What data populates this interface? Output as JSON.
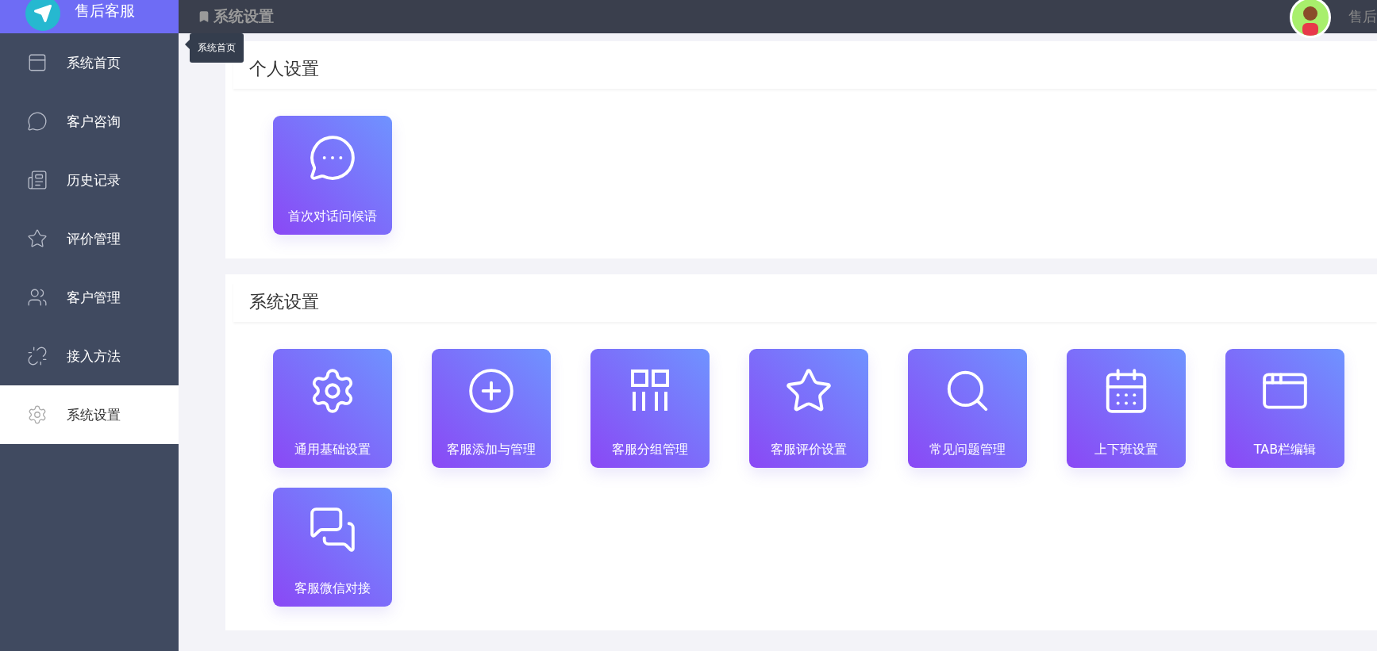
{
  "brand": {
    "title": "售后客服"
  },
  "sidebar": {
    "items": [
      {
        "label": "系统首页",
        "selected": false
      },
      {
        "label": "客户咨询",
        "selected": false
      },
      {
        "label": "历史记录",
        "selected": false
      },
      {
        "label": "评价管理",
        "selected": false
      },
      {
        "label": "客户管理",
        "selected": false
      },
      {
        "label": "接入方法",
        "selected": false
      },
      {
        "label": "系统设置",
        "selected": true
      }
    ]
  },
  "tooltip": "系统首页",
  "header": {
    "title": "系统设置",
    "user": "售后"
  },
  "sections": [
    {
      "title": "个人设置",
      "cards": [
        {
          "label": "首次对话问候语"
        }
      ]
    },
    {
      "title": "系统设置",
      "cards": [
        {
          "label": "通用基础设置"
        },
        {
          "label": "客服添加与管理"
        },
        {
          "label": "客服分组管理"
        },
        {
          "label": "客服评价设置"
        },
        {
          "label": "常见问题管理"
        },
        {
          "label": "上下班设置"
        },
        {
          "label": "TAB栏编辑"
        },
        {
          "label": "客服微信对接"
        }
      ]
    }
  ]
}
